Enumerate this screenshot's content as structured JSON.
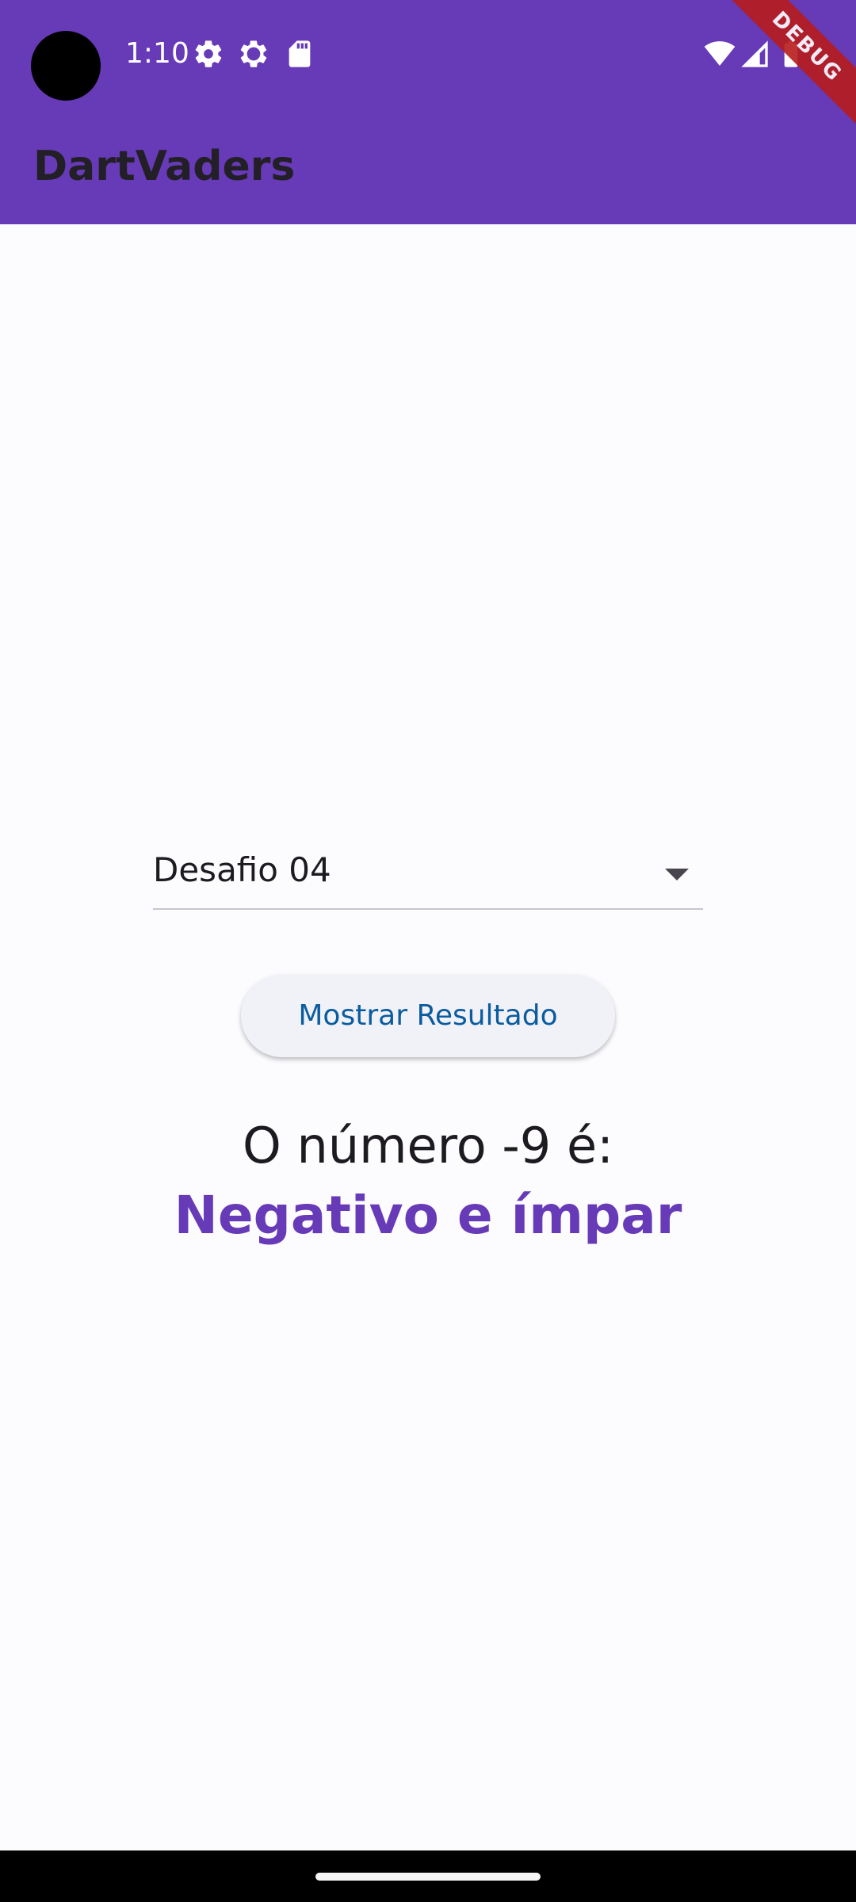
{
  "status_bar": {
    "time": "1:10",
    "icons": [
      "settings-icon",
      "debug-settings-icon",
      "sd-card-icon",
      "wifi-icon",
      "signal-icon",
      "battery-icon"
    ]
  },
  "debug_banner": "DEBUG",
  "app_bar": {
    "title": "DartVaders"
  },
  "dropdown": {
    "selected_value": "Desafio 04"
  },
  "button": {
    "label": "Mostrar Resultado"
  },
  "result": {
    "question": "O número -9 é:",
    "answer": "Negativo e ímpar"
  },
  "colors": {
    "primary": "#673ab7",
    "button_text": "#0b5c9e",
    "background": "#fcfbfe"
  }
}
